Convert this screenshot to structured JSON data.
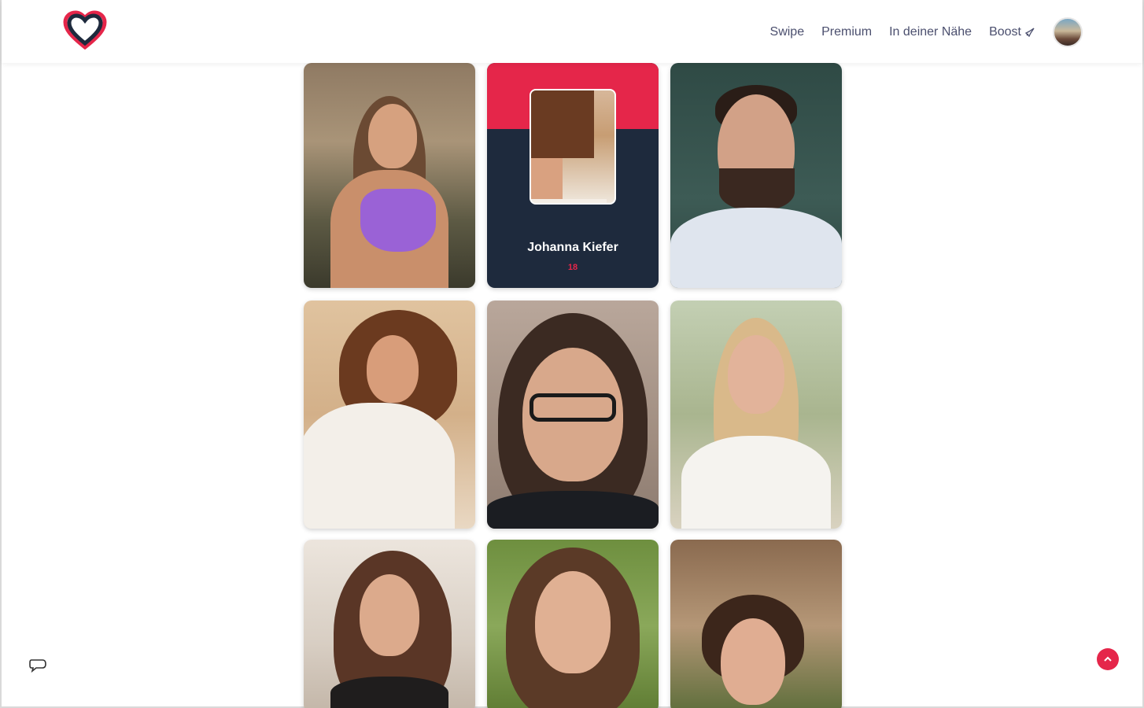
{
  "nav": {
    "links": [
      "Swipe",
      "Premium",
      "In deiner Nähe",
      "Boost"
    ]
  },
  "profile_card": {
    "name": "Johanna Kiefer",
    "age": "18"
  },
  "colors": {
    "accent": "#e5264a",
    "navy": "#1e2a3d",
    "nav_text": "#4b4f6e"
  },
  "icons": [
    "heart-logo-icon",
    "rocket-icon",
    "chat-bubble-icon",
    "chevron-up-icon"
  ]
}
